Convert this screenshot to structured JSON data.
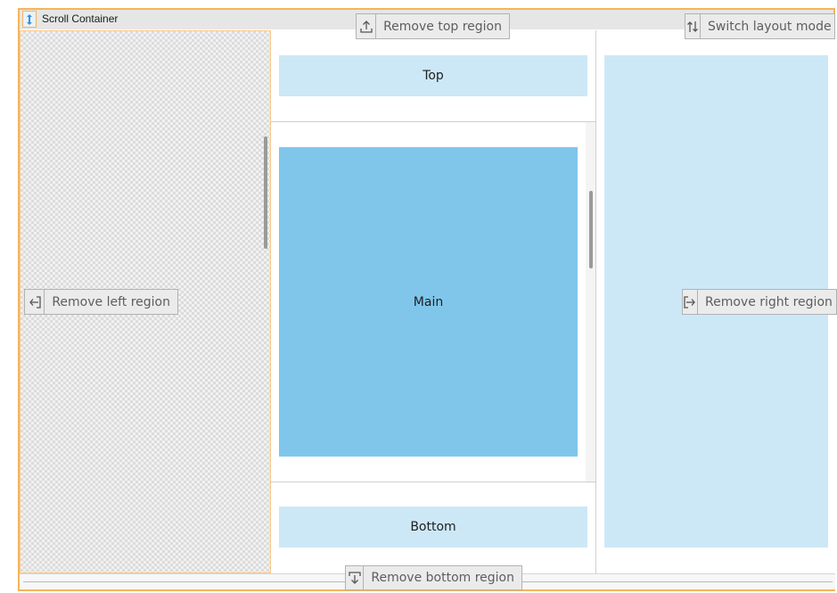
{
  "window": {
    "title": "Scroll Container"
  },
  "regions": {
    "top_label": "Top",
    "main_label": "Main",
    "bottom_label": "Bottom"
  },
  "buttons": {
    "remove_top": "Remove top region",
    "switch_layout": "Switch layout mode",
    "remove_left": "Remove left region",
    "remove_right": "Remove right region",
    "remove_bottom": "Remove bottom region"
  },
  "icons": {
    "remove_top": "arrow-up-icon",
    "switch_layout": "swap-icon",
    "remove_left": "arrow-left-icon",
    "remove_right": "arrow-right-icon",
    "remove_bottom": "arrow-down-icon"
  },
  "colors": {
    "accent_border": "#f5b45b",
    "light_block": "#cce8f6",
    "main_block": "#80c6eb"
  }
}
